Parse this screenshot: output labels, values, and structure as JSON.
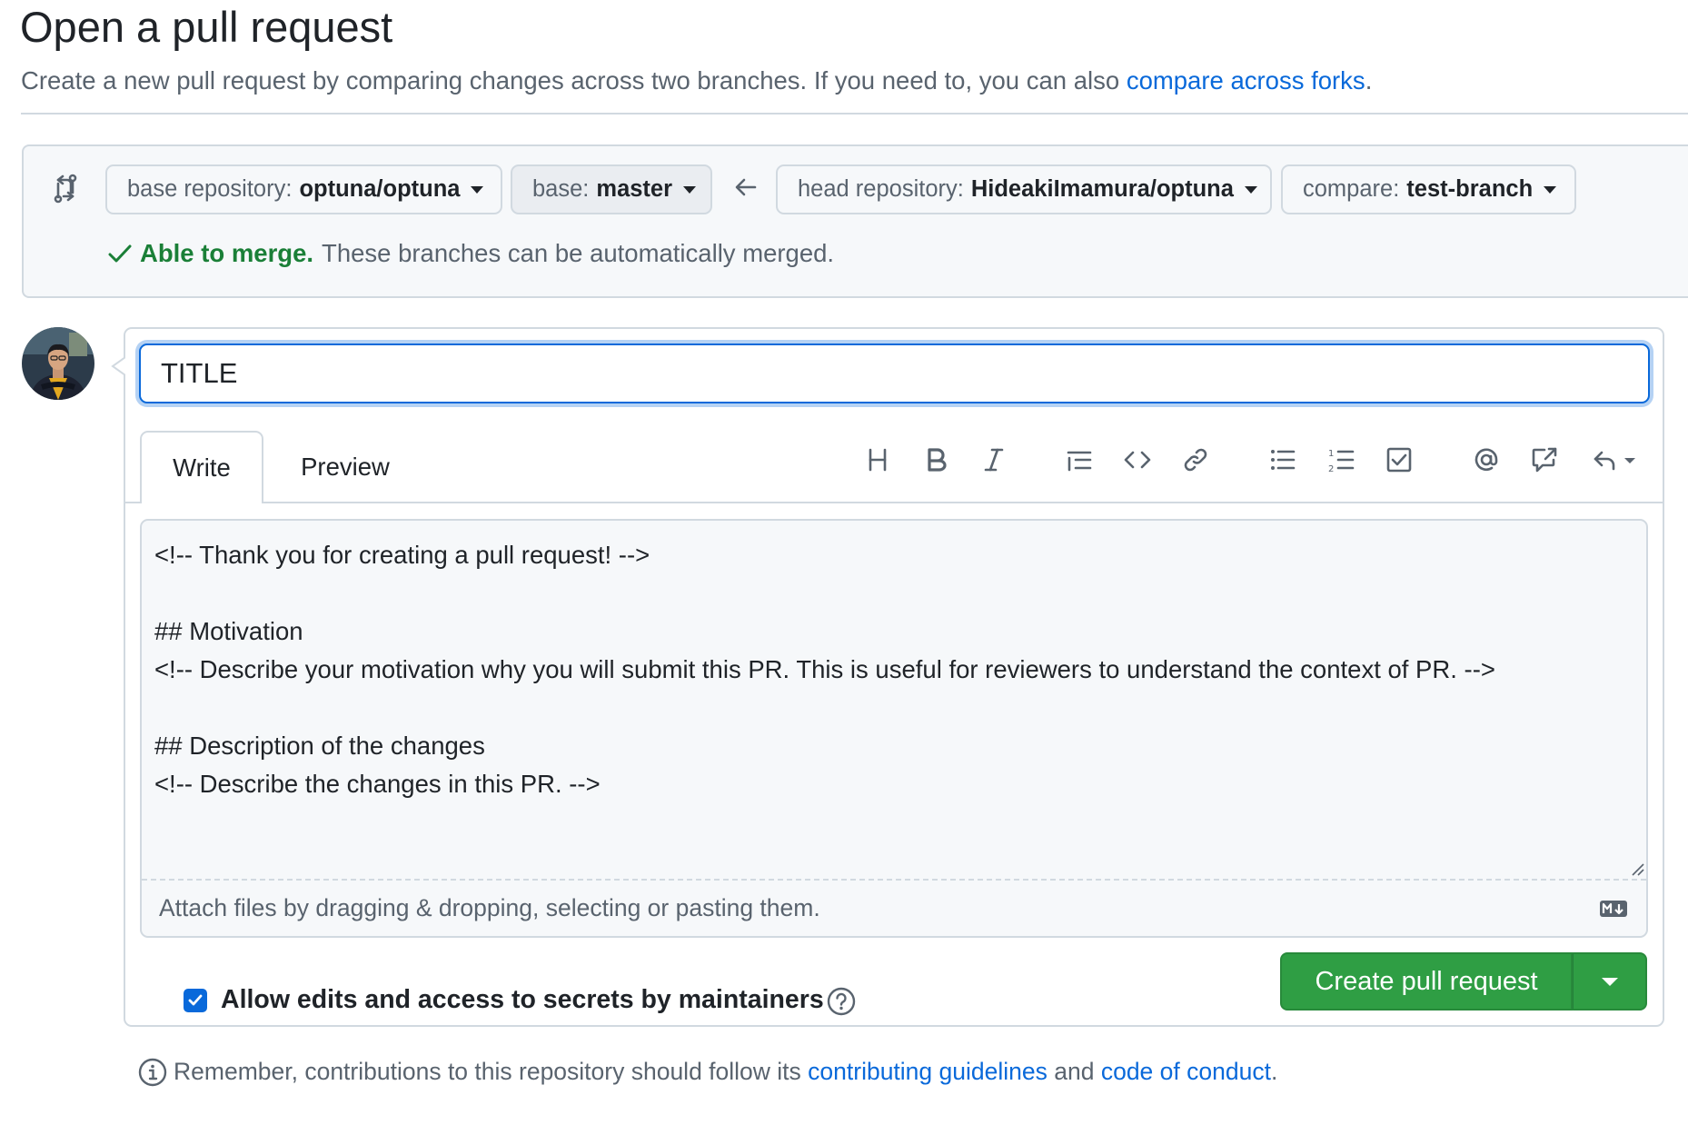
{
  "page": {
    "title": "Open a pull request",
    "subtitle": "Create a new pull request by comparing changes across two branches. If you need to, you can also ",
    "subtitle_link": "compare across forks",
    "subtitle_end": "."
  },
  "compare": {
    "base_repo_label": "base repository:",
    "base_repo_value": "optuna/optuna",
    "base_label": "base:",
    "base_value": "master",
    "head_repo_label": "head repository:",
    "head_repo_value": "HideakiImamura/optuna",
    "compare_label": "compare:",
    "compare_value": "test-branch",
    "merge_status": "Able to merge.",
    "merge_message": "These branches can be automatically merged."
  },
  "form": {
    "title_value": "TITLE",
    "tabs": {
      "write": "Write",
      "preview": "Preview"
    },
    "toolbar_icons": [
      "heading-icon",
      "bold-icon",
      "italic-icon",
      "quote-icon",
      "code-icon",
      "link-icon",
      "unordered-list-icon",
      "ordered-list-icon",
      "task-list-icon",
      "mention-icon",
      "reference-icon",
      "reply-icon"
    ],
    "body": "<!-- Thank you for creating a pull request! -->\n\n## Motivation\n<!-- Describe your motivation why you will submit this PR. This is useful for reviewers to understand the context of PR. -->\n\n## Description of the changes\n<!-- Describe the changes in this PR. -->",
    "attach_hint": "Attach files by dragging & dropping, selecting or pasting them.",
    "allow_edits_label": "Allow edits and access to secrets by maintainers",
    "allow_edits_checked": true,
    "create_button": "Create pull request"
  },
  "footer": {
    "prefix": "Remember, contributions to this repository should follow its ",
    "link1": "contributing guidelines",
    "middle": " and ",
    "link2": "code of conduct",
    "suffix": "."
  },
  "colors": {
    "accent": "#0969da",
    "success": "#1a7f37",
    "button_green": "#2f9e44"
  }
}
